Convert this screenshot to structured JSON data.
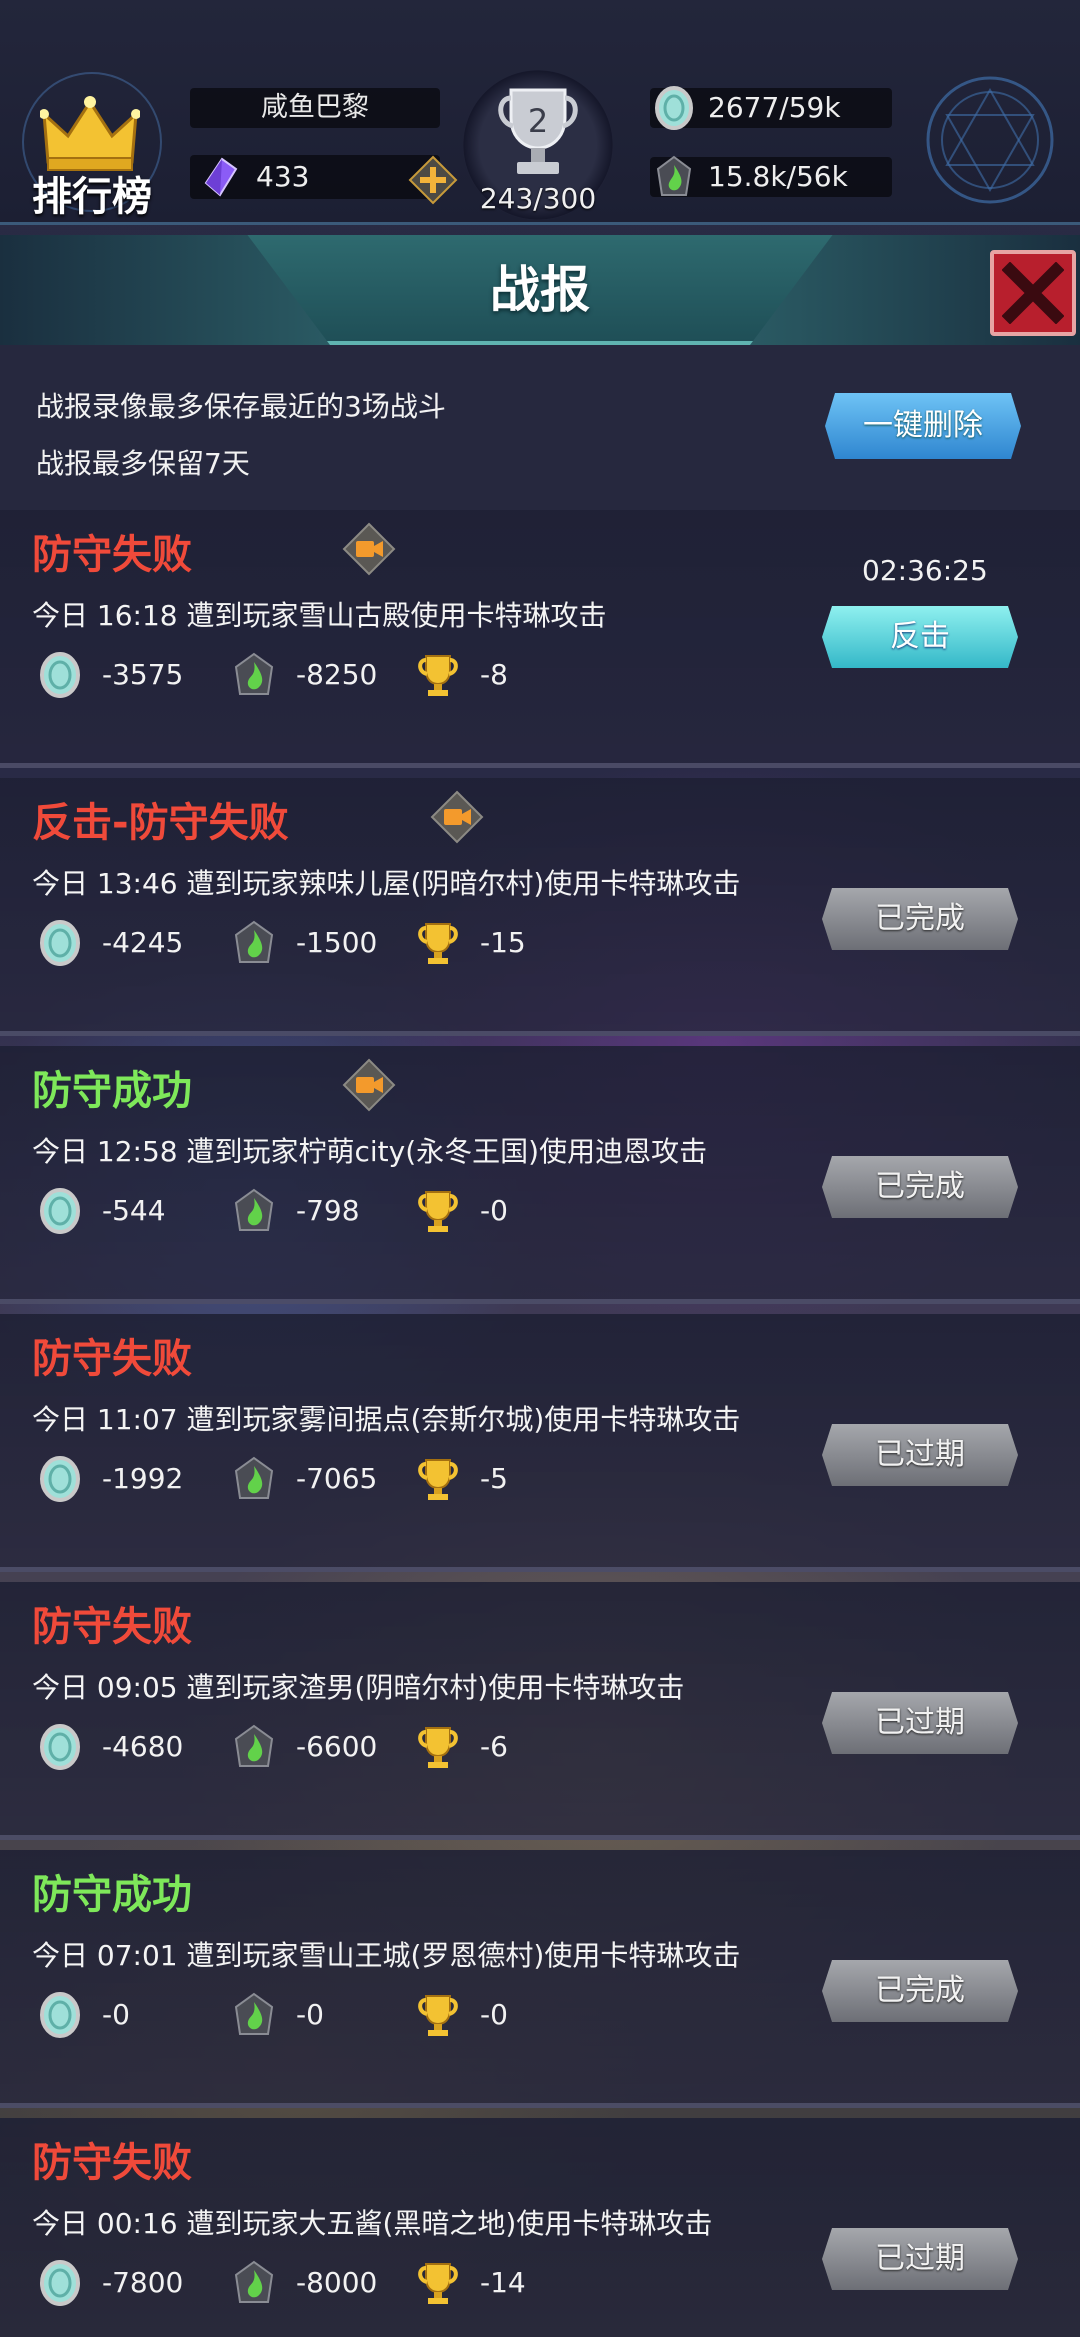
{
  "header": {
    "rank_label": "排行榜",
    "player_name": "咸鱼巴黎",
    "gems": "433",
    "trophy_level": "2",
    "trophy_progress": "243/300",
    "resource1": "2677/59k",
    "resource2": "15.8k/56k"
  },
  "panel": {
    "title": "战报"
  },
  "info": {
    "line1": "战报录像最多保存最近的3场战斗",
    "line2": "战报最多保留7天",
    "delete_all_label": "一键删除"
  },
  "records": [
    {
      "title": "防守失败",
      "result": "fail",
      "has_video": true,
      "desc": "今日 16:18 遭到玩家雪山古殿使用卡特琳攻击",
      "coin": "-3575",
      "elixir": "-8250",
      "trophy": "-8",
      "timer": "02:36:25",
      "action": "反击",
      "action_style": "cyan"
    },
    {
      "title": "反击-防守失败",
      "result": "fail",
      "has_video": true,
      "desc": "今日 13:46 遭到玩家辣味儿屋(阴暗尔村)使用卡特琳攻击",
      "coin": "-4245",
      "elixir": "-1500",
      "trophy": "-15",
      "timer": "",
      "action": "已完成",
      "action_style": "gray"
    },
    {
      "title": "防守成功",
      "result": "ok",
      "has_video": true,
      "desc": "今日 12:58 遭到玩家柠萌city(永冬王国)使用迪恩攻击",
      "coin": "-544",
      "elixir": "-798",
      "trophy": "-0",
      "timer": "",
      "action": "已完成",
      "action_style": "gray"
    },
    {
      "title": "防守失败",
      "result": "fail",
      "has_video": false,
      "desc": "今日 11:07 遭到玩家雾间据点(奈斯尔城)使用卡特琳攻击",
      "coin": "-1992",
      "elixir": "-7065",
      "trophy": "-5",
      "timer": "",
      "action": "已过期",
      "action_style": "gray"
    },
    {
      "title": "防守失败",
      "result": "fail",
      "has_video": false,
      "desc": "今日 09:05 遭到玩家渣男(阴暗尔村)使用卡特琳攻击",
      "coin": "-4680",
      "elixir": "-6600",
      "trophy": "-6",
      "timer": "",
      "action": "已过期",
      "action_style": "gray"
    },
    {
      "title": "防守成功",
      "result": "ok",
      "has_video": false,
      "desc": "今日 07:01 遭到玩家雪山王城(罗恩德村)使用卡特琳攻击",
      "coin": "-0",
      "elixir": "-0",
      "trophy": "-0",
      "timer": "",
      "action": "已完成",
      "action_style": "gray"
    },
    {
      "title": "防守失败",
      "result": "fail",
      "has_video": false,
      "desc": "今日 00:16 遭到玩家大五酱(黑暗之地)使用卡特琳攻击",
      "coin": "-7800",
      "elixir": "-8000",
      "trophy": "-14",
      "timer": "",
      "action": "已过期",
      "action_style": "gray"
    }
  ],
  "colors": {
    "fail": "#f04a3a",
    "success": "#7ee85a",
    "accent_blue": "#2f86d0",
    "accent_cyan": "#34b8c8",
    "close_red": "#b81f2d"
  }
}
